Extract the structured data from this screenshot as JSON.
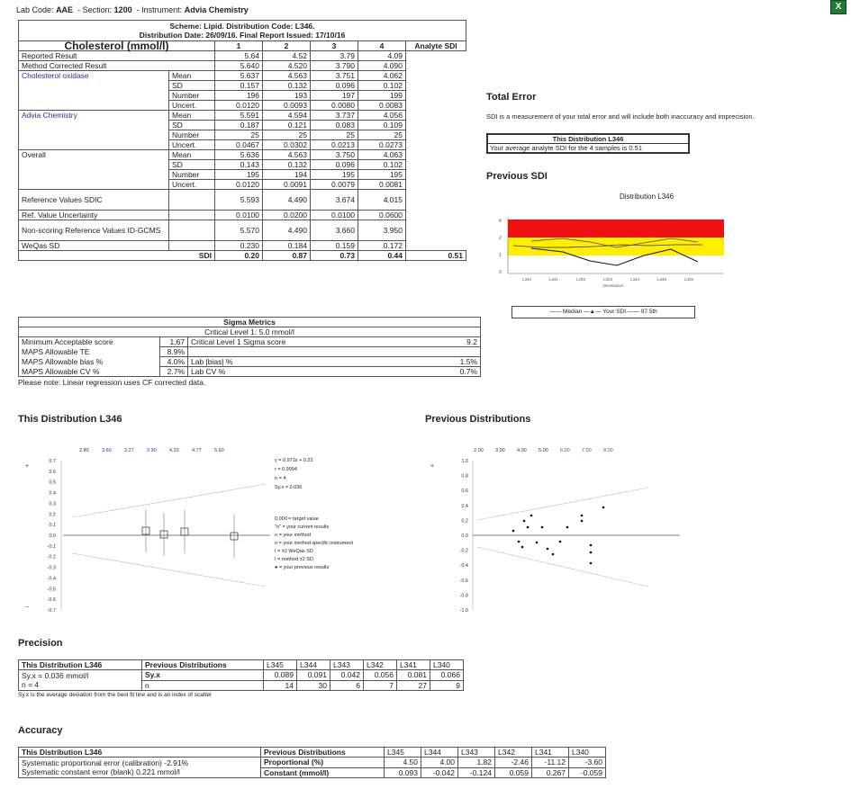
{
  "header": {
    "lab_code_label": "Lab Code:",
    "lab_code": "AAE",
    "section_label": "Section:",
    "section": "1200",
    "instrument_label": "Instrument:",
    "instrument": "Advia Chemistry"
  },
  "scheme": {
    "line1": "Scheme: Lipid. Distribution Code: L346.",
    "line2": "Distribution Date: 26/09/16. Final Report Issued: 17/10/16"
  },
  "main_table": {
    "analyte": "Cholesterol (mmol/l)",
    "columns": [
      "1",
      "2",
      "3",
      "4"
    ],
    "analyte_sdi_label": "Analyte SDI",
    "reported": {
      "label": "Reported Result",
      "values": [
        "5.64",
        "4.52",
        "3.79",
        "4.09"
      ]
    },
    "corrected": {
      "label": "Method Corrected Result",
      "values": [
        "5.640",
        "4.520",
        "3.790",
        "4.090"
      ]
    },
    "groups": [
      {
        "name": "Cholesterol oxidase",
        "rows": [
          {
            "stat": "Mean",
            "values": [
              "5.637",
              "4.563",
              "3.751",
              "4.062"
            ]
          },
          {
            "stat": "SD",
            "values": [
              "0.157",
              "0.132",
              "0.096",
              "0.102"
            ]
          },
          {
            "stat": "Number",
            "values": [
              "196",
              "193",
              "197",
              "199"
            ]
          },
          {
            "stat": "Uncert.",
            "values": [
              "0.0120",
              "0.0093",
              "0.0080",
              "0.0083"
            ]
          }
        ]
      },
      {
        "name": "Advia Chemistry",
        "rows": [
          {
            "stat": "Mean",
            "values": [
              "5.591",
              "4.594",
              "3.737",
              "4.056"
            ]
          },
          {
            "stat": "SD",
            "values": [
              "0.187",
              "0.121",
              "0.083",
              "0.109"
            ]
          },
          {
            "stat": "Number",
            "values": [
              "25",
              "25",
              "25",
              "25"
            ]
          },
          {
            "stat": "Uncert.",
            "values": [
              "0.0467",
              "0.0302",
              "0.0213",
              "0.0273"
            ]
          }
        ]
      },
      {
        "name": "Overall",
        "rows": [
          {
            "stat": "Mean",
            "values": [
              "5.636",
              "4.563",
              "3.750",
              "4.063"
            ]
          },
          {
            "stat": "SD",
            "values": [
              "0.143",
              "0.132",
              "0.096",
              "0.102"
            ]
          },
          {
            "stat": "Number",
            "values": [
              "195",
              "194",
              "195",
              "195"
            ]
          },
          {
            "stat": "Uncert.",
            "values": [
              "0.0120",
              "0.0091",
              "0.0079",
              "0.0081"
            ]
          }
        ]
      }
    ],
    "ref_values": {
      "label": "Reference Values SDIC",
      "values": [
        "5.593",
        "4.490",
        "3.674",
        "4.015"
      ]
    },
    "ref_uncert": {
      "label": "Ref. Value Uncertainty",
      "values": [
        "0.0100",
        "0.0200",
        "0.0100",
        "0.0600"
      ]
    },
    "nonscoring": {
      "label": "Non-scoring Reference Values ID-GCMS",
      "values": [
        "5.570",
        "4.490",
        "3.660",
        "3.950"
      ]
    },
    "weqas_sd": {
      "label": "WeQas SD",
      "values": [
        "0.230",
        "0.184",
        "0.159",
        "0.172"
      ]
    },
    "sdi": {
      "label": "SDI",
      "values": [
        "0.20",
        "0.87",
        "0.73",
        "0.44"
      ],
      "analyte": "0.51"
    }
  },
  "sigma": {
    "title": "Sigma Metrics",
    "critical": "Critical Level 1: 5.0 mmol/l",
    "rows": [
      {
        "label": "Minimum Acceptable score",
        "value": "1.67",
        "label2": "Critical Level 1 Sigma score",
        "value2": "9.2"
      },
      {
        "label": "MAPS Allowable TE",
        "value": "8.9%",
        "label2": "",
        "value2": ""
      },
      {
        "label": "MAPS Allowable bias %",
        "value": "4.0%",
        "label2": "Lab |bias| %",
        "value2": "1.5%"
      },
      {
        "label": "MAPS Allowable CV %",
        "value": "2.7%",
        "label2": "Lab CV %",
        "value2": "0.7%"
      }
    ],
    "note": "Please note: Linear regression uses CF corrected data."
  },
  "total_error": {
    "title": "Total Error",
    "desc": "SDI is a measurement of your total error and will include both inaccuracy and imprecision.",
    "box_title": "This Distribution L346",
    "box_text": "Your average analyte SDI for the 4 samples is 0.51"
  },
  "previous_sdi": {
    "title": "Previous SDI",
    "chart_title": "Distribution L346",
    "legend": [
      "Median",
      "Your SDI",
      "97.5th"
    ]
  },
  "this_dist": {
    "title": "This Distribution L346",
    "top_ticks": [
      "2.80",
      "3.60",
      "3.27",
      "3.90",
      "4.33",
      "4.77",
      "5.60"
    ],
    "yticks": [
      "0.7",
      "0.6",
      "0.5",
      "0.4",
      "0.3",
      "0.2",
      "0.1",
      "0.0",
      "-0.1",
      "-0.2",
      "-0.3",
      "-0.4",
      "-0.5",
      "-0.6",
      "-0.7"
    ],
    "stats": [
      "y = 0.971x + 0.22",
      "r = 0.9994",
      "n = 4",
      "Sy.x = 0.036"
    ],
    "legend": [
      "0.000 = target value",
      "\"o\" = your current results",
      "o = your method",
      "o = your method specific instrument",
      "I = ±2 WeQas SD",
      "I = method ±2 SD",
      "● = your previous results"
    ]
  },
  "prev_dist": {
    "title": "Previous Distributions",
    "top_ticks": [
      "2.00",
      "3.00",
      "4.00",
      "5.00",
      "6.00",
      "7.00",
      "8.00"
    ],
    "yticks": [
      "1.0",
      "0.8",
      "0.6",
      "0.4",
      "0.2",
      "0.0",
      "-0.2",
      "-0.4",
      "-0.6",
      "-0.8",
      "-1.0"
    ]
  },
  "precision": {
    "title": "Precision",
    "head_this": "This Distribution L346",
    "head_prev": "Previous Distributions",
    "dists": [
      "L345",
      "L344",
      "L343",
      "L342",
      "L341",
      "L340"
    ],
    "this_lines": [
      "Sy.x = 0.036 mmol/l",
      "n = 4"
    ],
    "syx_label": "Sy.x",
    "syx": [
      "0.089",
      "0.091",
      "0.042",
      "0.056",
      "0.081",
      "0.066"
    ],
    "n_label": "n",
    "n": [
      "14",
      "30",
      "6",
      "7",
      "27",
      "9"
    ],
    "footnote": "Sy.x is the average deviation from the best fit line and is an index of scatter"
  },
  "accuracy": {
    "title": "Accuracy",
    "head_this": "This Distribution L346",
    "head_prev": "Previous Distributions",
    "dists": [
      "L345",
      "L344",
      "L343",
      "L342",
      "L341",
      "L340"
    ],
    "line1": "Systematic proportional error (calibration) -2.91%",
    "line2": "Systematic constant error (blank) 0.221 mmol/l",
    "prop_label": "Proportional (%)",
    "prop": [
      "4.50",
      "4.00",
      "1.82",
      "-2.46",
      "-11.12",
      "-3.60"
    ],
    "const_label": "Constant (mmol/l)",
    "const": [
      "0.093",
      "-0.042",
      "-0.124",
      "0.059",
      "0.267",
      "-0.059"
    ]
  },
  "colors": {
    "band_red": "#ee1111",
    "band_yellow": "#ffee00",
    "excel_green": "#1e7a35"
  }
}
